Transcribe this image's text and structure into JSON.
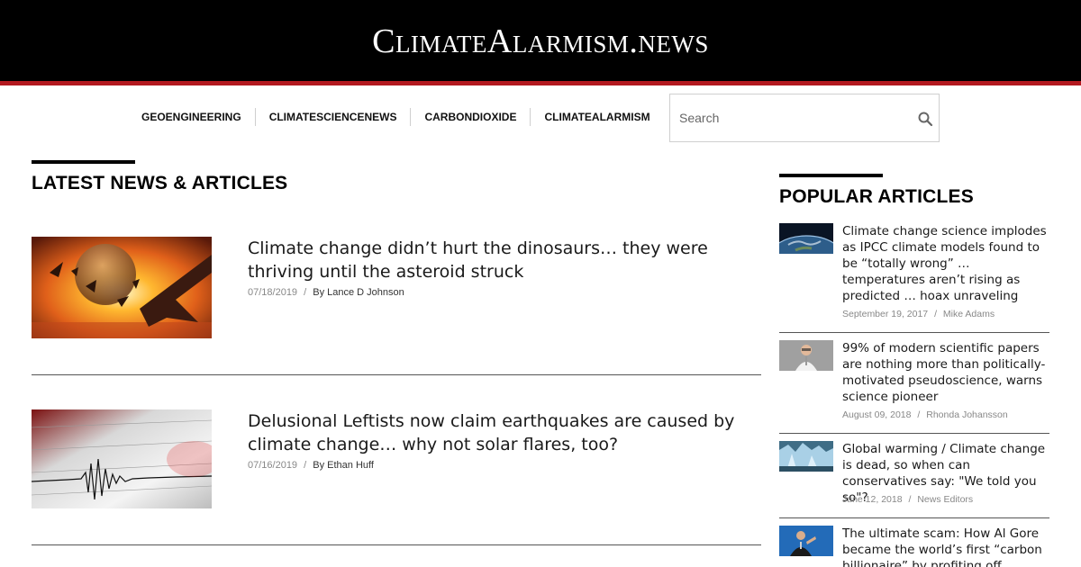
{
  "site": {
    "logo_text": "ClimateAlarmism.news",
    "header_bg": "#000000",
    "accent_color": "#b3191f"
  },
  "nav": {
    "items": [
      {
        "label": "GEOENGINEERING"
      },
      {
        "label": "CLIMATESCIENCENEWS"
      },
      {
        "label": "CARBONDIOXIDE"
      },
      {
        "label": "CLIMATEALARMISM"
      }
    ]
  },
  "search": {
    "placeholder": "Search",
    "icon": "search-icon"
  },
  "latest": {
    "heading": "LATEST NEWS & ARTICLES",
    "articles": [
      {
        "title": "Climate change didn’t hurt the dinosaurs… they were thriving until the asteroid struck",
        "date": "07/18/2019",
        "author": "By Lance D Johnson",
        "image": "asteroid-pterodactyl-image"
      },
      {
        "title": "Delusional Leftists now claim earthquakes are caused by climate change… why not solar flares, too?",
        "date": "07/16/2019",
        "author": "By Ethan Huff",
        "image": "seismograph-image"
      }
    ]
  },
  "popular": {
    "heading": "POPULAR ARTICLES",
    "articles": [
      {
        "title": "Climate change science implodes as IPCC climate models found to be “totally wrong” … temperatures aren’t rising as predicted … hoax unraveling",
        "date": "September 19, 2017",
        "author": "Mike Adams",
        "image": "earth-image"
      },
      {
        "title": "99% of modern scientific papers are nothing more than politically-motivated pseudoscience, warns science pioneer",
        "date": "August 09, 2018",
        "author": "Rhonda Johansson",
        "image": "scientist-image"
      },
      {
        "title": "Global warming / Climate change is dead, so when can conservatives say: \"We told you so\"?",
        "date": "June 12, 2018",
        "author": "News Editors",
        "image": "glacier-image"
      },
      {
        "title": "The ultimate scam: How Al Gore became the world’s first “carbon billionaire” by profiting off",
        "image": "al-gore-image"
      }
    ]
  }
}
